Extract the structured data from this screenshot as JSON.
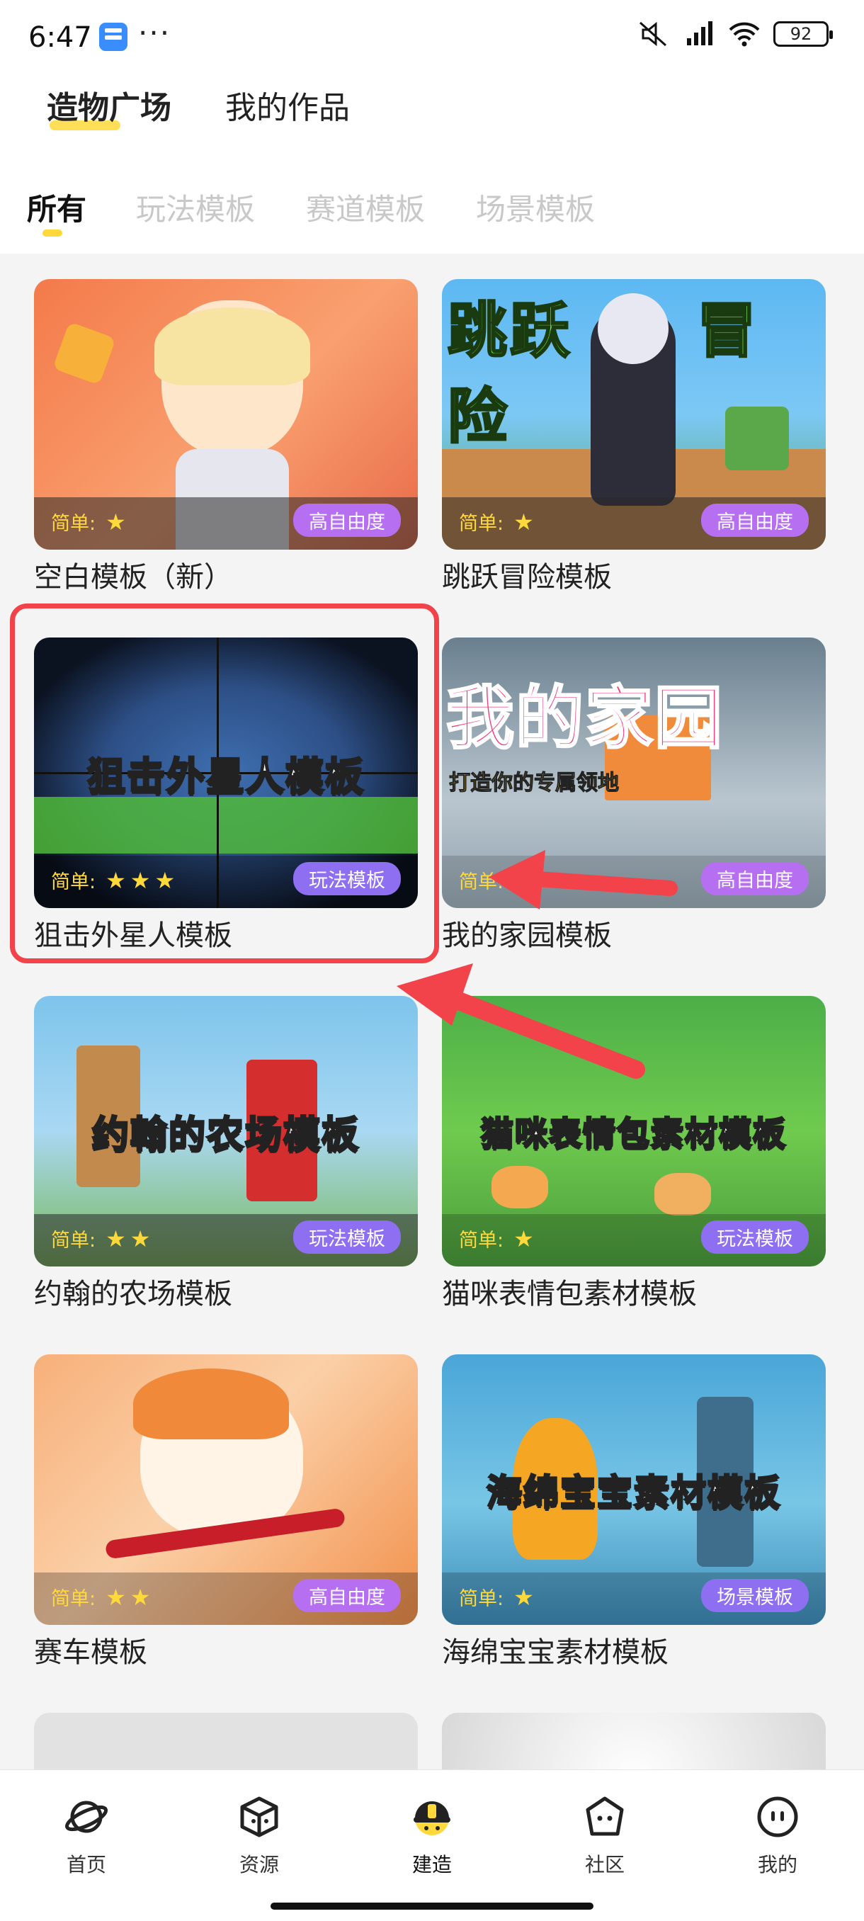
{
  "status_bar": {
    "time": "6:47",
    "dots": "···",
    "battery": "92"
  },
  "top_nav": {
    "items": [
      {
        "label": "造物广场",
        "active": true
      },
      {
        "label": "我的作品",
        "active": false
      }
    ]
  },
  "tabs": [
    {
      "label": "所有",
      "active": true
    },
    {
      "label": "玩法模板"
    },
    {
      "label": "赛道模板"
    },
    {
      "label": "场景模板"
    }
  ],
  "difficulty_label": "简单:",
  "cards": [
    {
      "title": "空白模板（新）",
      "stars": 1,
      "badge": "高自由度",
      "thumb_text": ""
    },
    {
      "title": "跳跃冒险模板",
      "stars": 1,
      "badge": "高自由度",
      "thumb_text": "跳跃　　冒险"
    },
    {
      "title": "狙击外星人模板",
      "stars": 3,
      "badge": "玩法模板",
      "thumb_text": "狙击外星人模板"
    },
    {
      "title": "我的家园模板",
      "stars": 1,
      "badge": "高自由度",
      "thumb_text": "我的家园",
      "thumb_sub": "打造你的专属领地"
    },
    {
      "title": "约翰的农场模板",
      "stars": 2,
      "badge": "玩法模板",
      "thumb_text": "约翰的农场模板"
    },
    {
      "title": "猫咪表情包素材模板",
      "stars": 1,
      "badge": "玩法模板",
      "thumb_text": "猫咪表情包素材模板"
    },
    {
      "title": "赛车模板",
      "stars": 2,
      "badge": "高自由度",
      "thumb_text": ""
    },
    {
      "title": "海绵宝宝素材模板",
      "stars": 1,
      "badge": "场景模板",
      "thumb_text": "海绵宝宝素材模板"
    }
  ],
  "bottom_nav": [
    {
      "label": "首页",
      "icon": "planet-icon"
    },
    {
      "label": "资源",
      "icon": "cube-icon"
    },
    {
      "label": "建造",
      "icon": "hardhat-icon",
      "active": true
    },
    {
      "label": "社区",
      "icon": "community-icon"
    },
    {
      "label": "我的",
      "icon": "profile-icon"
    }
  ],
  "colors": {
    "accent": "#ffd93b",
    "badge_purple": "#b76ff2",
    "badge_violet": "#8e6ff2",
    "highlight_red": "#f2424a"
  }
}
